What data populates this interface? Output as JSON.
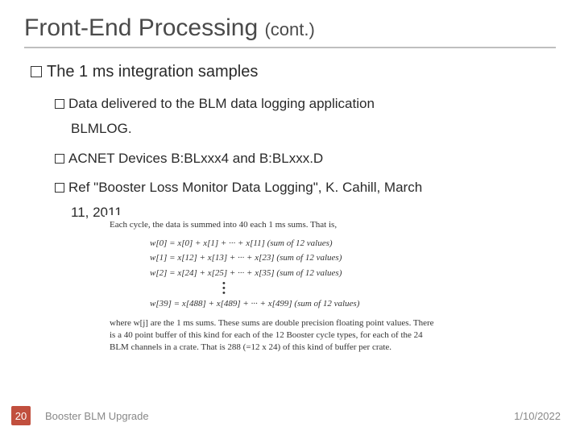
{
  "title": {
    "main": "Front-End Processing",
    "cont": "(cont.)"
  },
  "bullets": {
    "b1": "The 1 ms integration samples",
    "b2a_line1": "Data delivered to the BLM data logging application",
    "b2a_line2": "BLMLOG.",
    "b2b": "ACNET Devices B:BLxxx4 and B:BLxxx.D",
    "b2c_line1": "Ref \"Booster Loss Monitor Data Logging\", K. Cahill, March",
    "b2c_line2": "11, 2011"
  },
  "inset": {
    "top_caption": "Each cycle, the data is summed into 40 each 1 ms sums. That is,",
    "f0": "w[0] = x[0] + x[1] + ··· + x[11] (sum of 12 values)",
    "f1": "w[1] = x[12] + x[13] + ··· + x[23] (sum of 12 values)",
    "f2": "w[2] = x[24] + x[25] + ··· + x[35] (sum of 12 values)",
    "f39": "w[39] = x[488] + x[489] + ··· + x[499] (sum of 12 values)",
    "bottom_caption": "where w[j] are the 1 ms sums. These sums are double precision floating point values. There is a 40 point buffer of this kind for each of the 12 Booster cycle types, for each of the 24 BLM channels in a crate. That is 288 (=12 x 24) of this kind of buffer per crate."
  },
  "footer": {
    "number": "20",
    "text": "Booster BLM Upgrade",
    "date": "1/10/2022"
  }
}
